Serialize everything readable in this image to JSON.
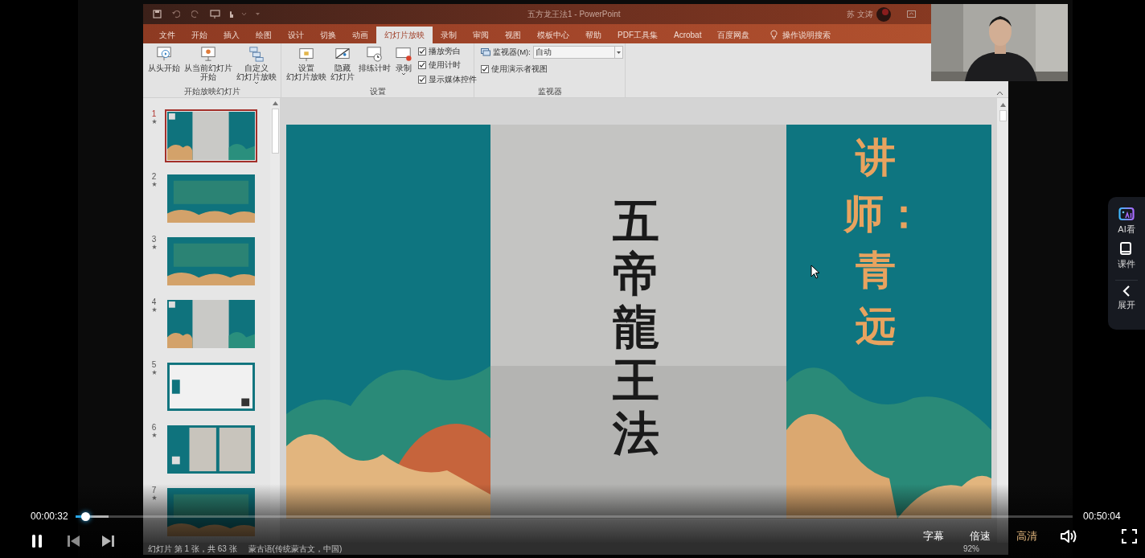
{
  "ppt_window": {
    "title": "五方龙王法1 - PowerPoint",
    "user": "苏 文涛",
    "tabs": [
      {
        "label": "文件",
        "selected": false
      },
      {
        "label": "开始",
        "selected": false
      },
      {
        "label": "插入",
        "selected": false
      },
      {
        "label": "绘图",
        "selected": false
      },
      {
        "label": "设计",
        "selected": false
      },
      {
        "label": "切换",
        "selected": false
      },
      {
        "label": "动画",
        "selected": false
      },
      {
        "label": "幻灯片放映",
        "selected": true
      },
      {
        "label": "录制",
        "selected": false
      },
      {
        "label": "审阅",
        "selected": false
      },
      {
        "label": "视图",
        "selected": false
      },
      {
        "label": "模板中心",
        "selected": false
      },
      {
        "label": "帮助",
        "selected": false
      },
      {
        "label": "PDF工具集",
        "selected": false
      },
      {
        "label": "Acrobat",
        "selected": false
      },
      {
        "label": "百度网盘",
        "selected": false
      }
    ],
    "search": "操作说明搜索",
    "ribbon_groups": [
      {
        "label": "开始放映幻灯片",
        "items": [
          {
            "kind": "button",
            "lines": [
              "从头开始"
            ]
          },
          {
            "kind": "button",
            "lines": [
              "从当前幻灯片",
              "开始"
            ]
          },
          {
            "kind": "dropdown_button",
            "lines": [
              "自定义",
              "幻灯片放映"
            ]
          }
        ]
      },
      {
        "label": "设置",
        "items": [
          {
            "kind": "button",
            "lines": [
              "设置",
              "幻灯片放映"
            ]
          },
          {
            "kind": "button",
            "lines": [
              "隐藏",
              "幻灯片"
            ]
          },
          {
            "kind": "button",
            "lines": [
              "排练计时"
            ]
          },
          {
            "kind": "dropdown_button",
            "lines": [
              "录制"
            ]
          },
          {
            "kind": "checkbox",
            "label": "播放旁白",
            "checked": true
          },
          {
            "kind": "checkbox",
            "label": "使用计时",
            "checked": true
          },
          {
            "kind": "checkbox",
            "label": "显示媒体控件",
            "checked": true
          }
        ]
      },
      {
        "label": "监视器",
        "items": [
          {
            "kind": "select",
            "label": "监视器(M):",
            "value": "自动"
          },
          {
            "kind": "checkbox",
            "label": "使用演示者视图",
            "checked": true
          }
        ]
      }
    ],
    "slides": [
      {
        "number": "1",
        "selected": true
      },
      {
        "number": "2",
        "selected": false
      },
      {
        "number": "3",
        "selected": false
      },
      {
        "number": "4",
        "selected": false
      },
      {
        "number": "5",
        "selected": false
      },
      {
        "number": "6",
        "selected": false
      },
      {
        "number": "7",
        "selected": false
      }
    ],
    "slide": {
      "title": "五帝龍王法",
      "lecturer": "讲师：青远"
    },
    "status_bar": [
      "幻灯片 第 1 张，共 63 张",
      "蒙古语(传统蒙古文，中国)",
      "92%"
    ]
  },
  "player": {
    "elapsed": "00:00:32",
    "duration": "00:50:04",
    "level": 0.01,
    "buffer": {
      "level": 0.033
    },
    "playing": true,
    "options": [
      {
        "label": "字幕",
        "selected": false
      },
      {
        "label": "倍速",
        "selected": false
      },
      {
        "label": "高清",
        "selected": true
      }
    ],
    "side_panel": [
      {
        "label": "AI看"
      },
      {
        "label": "课件"
      },
      {
        "label": "展开"
      }
    ]
  }
}
